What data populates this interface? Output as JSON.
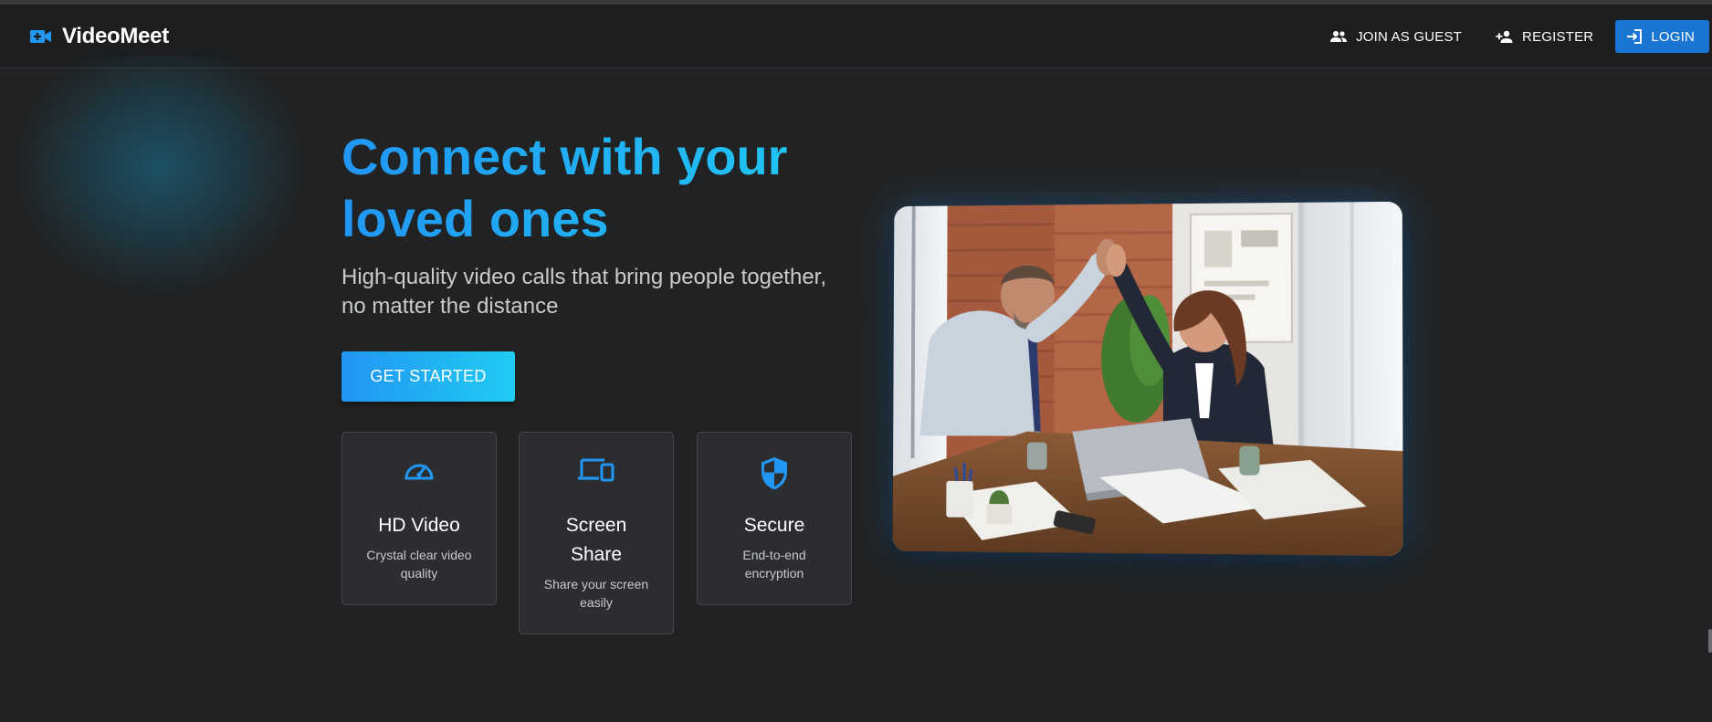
{
  "brand": {
    "name": "VideoMeet",
    "icon": "video-camera-plus-icon",
    "accent": "#2196f3"
  },
  "nav": {
    "join_guest": {
      "label": "JOIN AS GUEST",
      "icon": "people-icon"
    },
    "register": {
      "label": "REGISTER",
      "icon": "person-add-icon"
    },
    "login": {
      "label": "LOGIN",
      "icon": "login-icon",
      "color": "#1976d2"
    }
  },
  "hero": {
    "title": "Connect with your loved ones",
    "subtitle": "High-quality video calls that bring people together, no matter the distance",
    "cta": "GET STARTED",
    "gradient": [
      "#2196f3",
      "#21cbf3"
    ]
  },
  "features": [
    {
      "icon": "speedometer-icon",
      "title": "HD Video",
      "description": "Crystal clear video quality"
    },
    {
      "icon": "devices-icon",
      "title": "Screen Share",
      "description": "Share your screen easily"
    },
    {
      "icon": "security-shield-icon",
      "title": "Secure",
      "description": "End-to-end encryption"
    }
  ],
  "hero_image": {
    "icon": "office-high-five-photo"
  }
}
